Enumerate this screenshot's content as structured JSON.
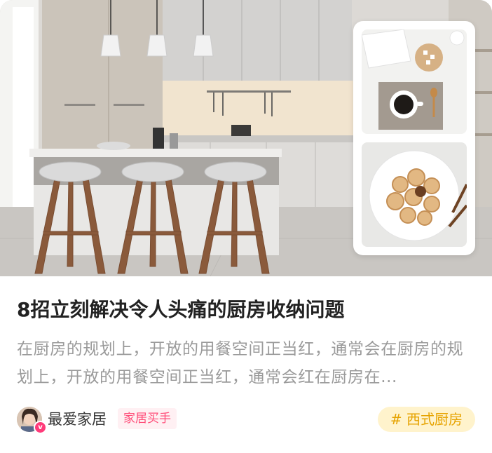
{
  "article": {
    "title": "8招立刻解决令人头痛的厨房收纳问题",
    "description": "在厨房的规划上，开放的用餐空间正当红，通常会在厨房的规划上，开放的用餐空间正当红，通常会红在厨房在..."
  },
  "author": {
    "name": "最爱家居",
    "role_badge": "家居买手",
    "verified_mark": "v"
  },
  "tag": {
    "label": "# 西式厨房"
  },
  "colors": {
    "title": "#222222",
    "description": "#9a9a9a",
    "role_badge_text": "#ff4d79",
    "tag_text": "#e6a300",
    "tag_bg": "#fff3cc"
  },
  "images": {
    "hero": "kitchen-island-photo",
    "thumb_1": "coffee-cup-photo",
    "thumb_2": "cookies-plate-photo"
  }
}
